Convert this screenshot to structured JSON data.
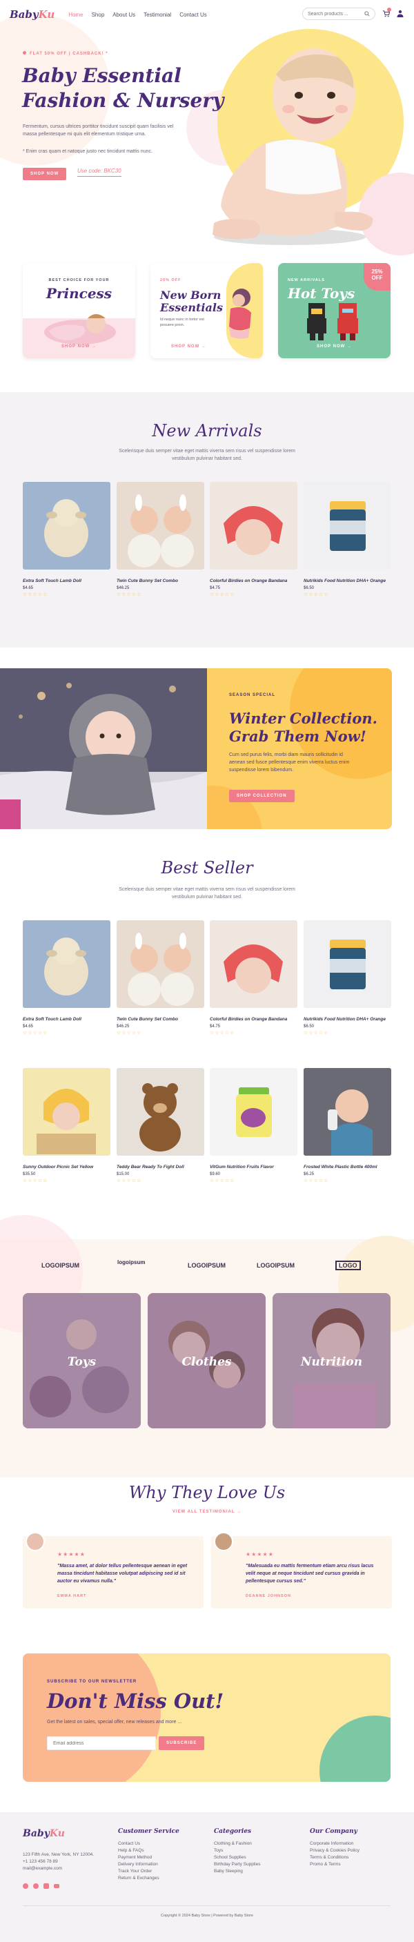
{
  "header": {
    "logo_a": "Baby",
    "logo_b": "Ku",
    "nav": [
      "Home",
      "Shop",
      "About Us",
      "Testimonial",
      "Contact Us"
    ],
    "search_placeholder": "Search products ..."
  },
  "hero": {
    "tag": "FLAT 50% OFF | CASHBACK! *",
    "title_l1": "Baby Essential",
    "title_l2": "Fashion & Nursery",
    "desc": "Fermentum, cursus ultrices porttitor tincidunt suscipit quam facilisis vel massa pellentesque mi quis elit elementum tristique urna.",
    "note": "* Enim cras quam et natoque justo nec tincidunt mattis nunc.",
    "btn": "SHOP NOW",
    "code": "Use code: BKC30"
  },
  "cards": [
    {
      "label": "BEST CHOICE FOR YOUR",
      "title": "Princess",
      "link": "SHOP NOW →"
    },
    {
      "label": "20% OFF",
      "title_l1": "New Born",
      "title_l2": "Essentials",
      "desc": "Id neque nunc in tortor est posuere proin.",
      "link": "SHOP NOW →"
    },
    {
      "label": "NEW ARRIVALS",
      "title": "Hot Toys",
      "badge_l1": "25%",
      "badge_l2": "OFF",
      "link": "SHOP NOW →"
    }
  ],
  "new_arrivals": {
    "title": "New Arrivals",
    "sub": "Scelerisque duis semper vitae eget mattis viverra sem risus vel suspendisse lorem vestibulum pulvinar habitant sed.",
    "items": [
      {
        "name": "Extra Soft Touch Lamb Doll",
        "price": "$4.65",
        "stars": "☆☆☆☆☆"
      },
      {
        "name": "Twin Cute Bunny Set Combo",
        "price": "$46.25",
        "stars": "☆☆☆☆☆"
      },
      {
        "name": "Colorful Birdies on Orange Bandana",
        "price": "$4.75",
        "stars": "☆☆☆☆☆"
      },
      {
        "name": "Nutrikids Food Nutrition DHA+ Orange",
        "price": "$6.50",
        "stars": "☆☆☆☆☆"
      }
    ]
  },
  "winter": {
    "label": "SEASON SPECIAL",
    "title_l1": "Winter Collection.",
    "title_l2": "Grab Them Now!",
    "desc": "Cum sed purus felis, morbi diam mauris sollicitudin id aenean sed fusce pellentesque enim viverra luctus enim suspendisse lorem bibendum.",
    "btn": "SHOP COLLECTION"
  },
  "best_seller": {
    "title": "Best Seller",
    "sub": "Scelerisque duis semper vitae eget mattis viverra sem risus vel suspendisse lorem vestibulum pulvinar habitant sed.",
    "items": [
      {
        "name": "Extra Soft Touch Lamb Doll",
        "price": "$4.65",
        "stars": "☆☆☆☆☆"
      },
      {
        "name": "Twin Cute Bunny Set Combo",
        "price": "$46.25",
        "stars": "☆☆☆☆☆"
      },
      {
        "name": "Colorful Birdies on Orange Bandana",
        "price": "$4.75",
        "stars": "☆☆☆☆☆"
      },
      {
        "name": "Nutrikids Food Nutrition DHA+ Orange",
        "price": "$6.50",
        "stars": "☆☆☆☆☆"
      },
      {
        "name": "Sunny Outdoor Picnic Set Yellow",
        "price": "$35.50",
        "stars": "☆☆☆☆☆"
      },
      {
        "name": "Teddy Bear Ready To Fight Doll",
        "price": "$15.00",
        "stars": "☆☆☆☆☆"
      },
      {
        "name": "VitGum Nutrition Fruits Flavor",
        "price": "$9.60",
        "stars": "☆☆☆☆☆"
      },
      {
        "name": "Frosted White Plastic Bottle 400ml",
        "price": "$6.25",
        "stars": "☆☆☆☆☆"
      }
    ]
  },
  "brands": [
    "LOGOIPSUM",
    "logoipsum",
    "LOGOIPSUM",
    "LOGOIPSUM",
    "LOGO"
  ],
  "categories": [
    "Toys",
    "Clothes",
    "Nutrition"
  ],
  "testimonials": {
    "title": "Why They Love Us",
    "link": "VIEW ALL TESTIMONIAL →",
    "items": [
      {
        "stars": "★★★★★",
        "quote": "\"Massa amet, at dolor tellus pellentesque aenean in eget massa tincidunt habitasse volutpat adipiscing sed id sit auctor eu vivamus nulla.\"",
        "name": "EMMA HART"
      },
      {
        "stars": "★★★★★",
        "quote": "\"Malesuada eu mattis fermentum etiam arcu risus lacus velit neque at neque tincidunt sed cursus gravida in pellentesque cursus sed.\"",
        "name": "DEANNE JOHNSON"
      }
    ]
  },
  "newsletter": {
    "label": "SUBSCRIBE TO OUR NEWSLETTER",
    "title": "Don't Miss Out!",
    "desc": "Get the latest on sales, special offer, new releases and more ...",
    "placeholder": "Email address",
    "btn": "SUBSCRIBE"
  },
  "footer": {
    "address_l1": "123 Fifth Ave, New York, NY 12004.",
    "address_l2": "+1 123 456 78 89",
    "address_l3": "mail@example.com",
    "cols": [
      {
        "title": "Customer Service",
        "items": [
          "Contact Us",
          "Help & FAQs",
          "Payment Method",
          "Delivery Information",
          "Track Your Order",
          "Return & Exchanges"
        ]
      },
      {
        "title": "Categories",
        "items": [
          "Clothing & Fashion",
          "Toys",
          "School Supplies",
          "Birthday Party Supplies",
          "Baby Sleeping"
        ]
      },
      {
        "title": "Our Company",
        "items": [
          "Corporate Information",
          "Privacy & Cookies Policy",
          "Terms & Conditions",
          "Promo & Terms"
        ]
      }
    ],
    "copyright": "Copyright © 2024 Baby Store | Powered by Baby Store"
  },
  "colors": {
    "purple": "#4b2c7a",
    "pink": "#f07c8a",
    "yellow": "#fde58a",
    "grey": "#f4f2f5"
  }
}
